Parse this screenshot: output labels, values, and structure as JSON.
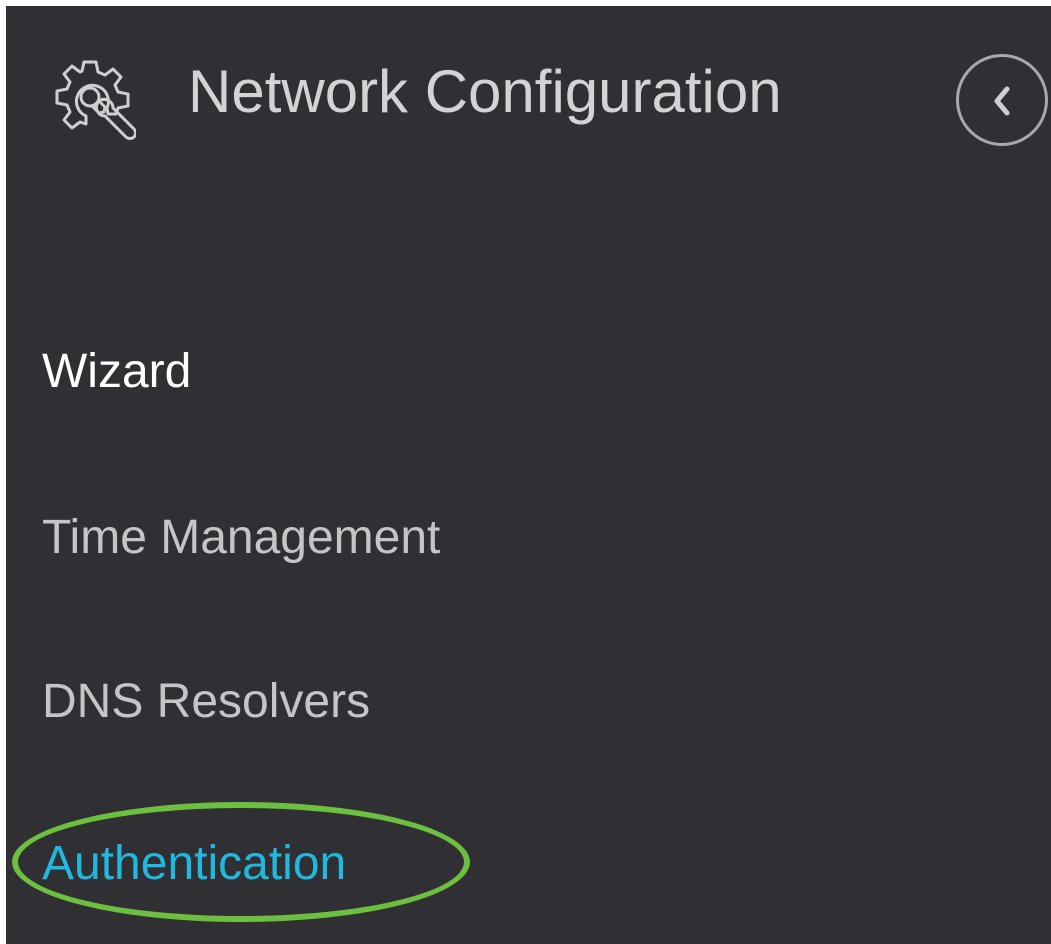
{
  "header": {
    "title": "Network Configuration",
    "icon": "gear-wrench-icon",
    "collapse_icon": "chevron-left-icon"
  },
  "menu": {
    "items": [
      {
        "label": "Wizard",
        "state": "hover"
      },
      {
        "label": "Time Management",
        "state": "normal"
      },
      {
        "label": "DNS Resolvers",
        "state": "normal"
      },
      {
        "label": "Authentication",
        "state": "active",
        "highlighted": true
      }
    ]
  },
  "colors": {
    "background": "#302f33",
    "title_text": "#d3d3d6",
    "item_text": "#c5c5c8",
    "item_hover_text": "#ffffff",
    "active_text": "#21b8df",
    "highlight_ring": "#6cbf3f"
  }
}
